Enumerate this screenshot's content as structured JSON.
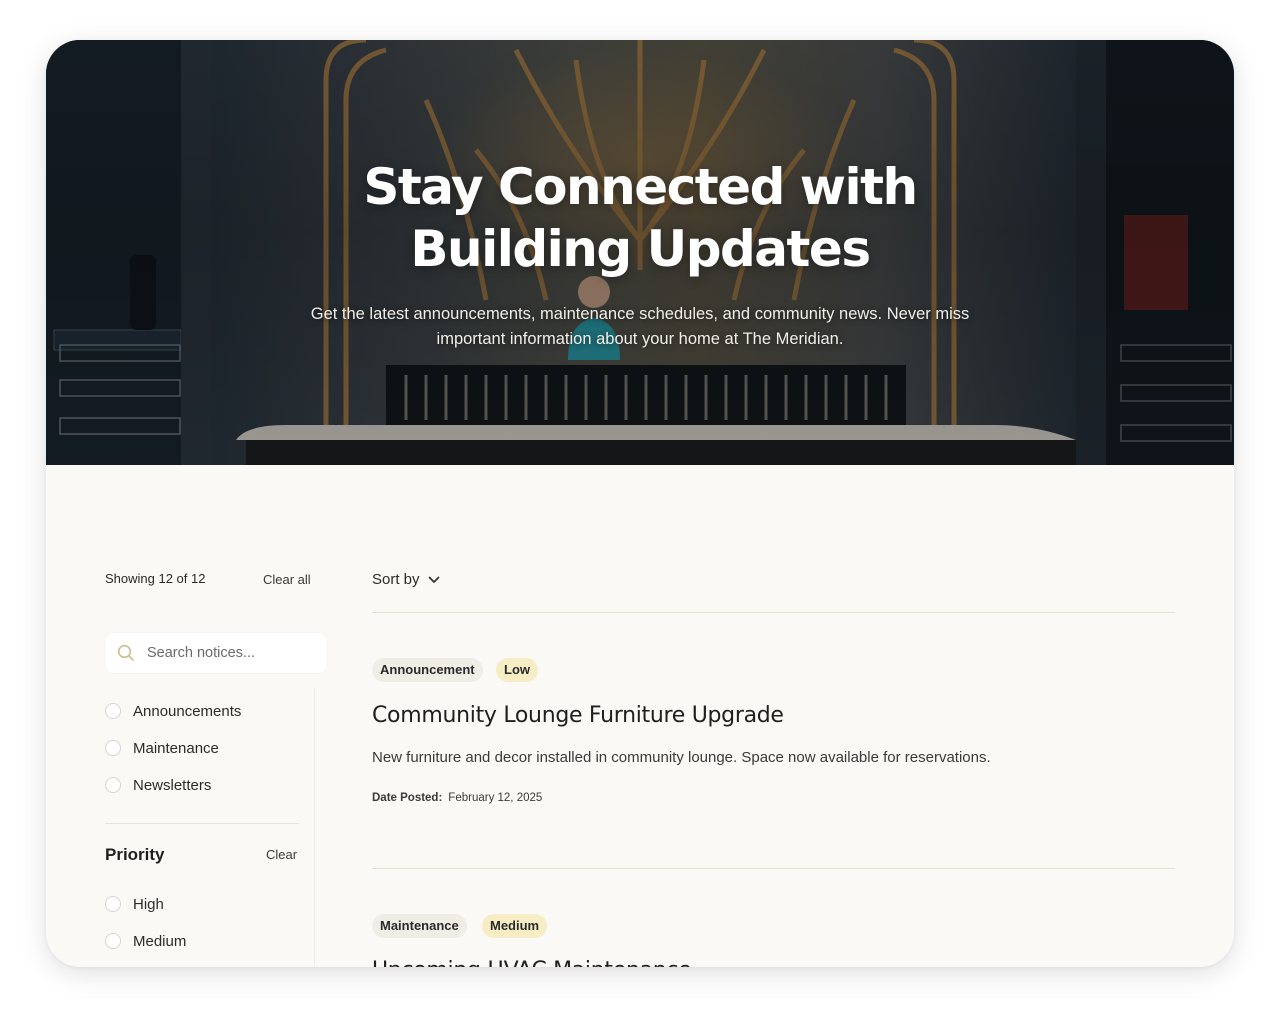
{
  "hero": {
    "title_line1": "Stay Connected with",
    "title_line2": "Building Updates",
    "subtitle_line1": "Get the latest announcements, maintenance schedules, and community news. Never miss",
    "subtitle_line2": "important information about your home at The Meridian."
  },
  "results": {
    "showing": "Showing 12 of 12",
    "clear_all": "Clear all"
  },
  "search": {
    "placeholder": "Search notices..."
  },
  "categories": [
    {
      "label": "Announcements"
    },
    {
      "label": "Maintenance"
    },
    {
      "label": "Newsletters"
    }
  ],
  "priority": {
    "title": "Priority",
    "clear": "Clear",
    "options": [
      {
        "label": "High"
      },
      {
        "label": "Medium"
      }
    ]
  },
  "sort": {
    "label": "Sort by"
  },
  "notices": [
    {
      "category": "Announcement",
      "priority": "Low",
      "title": "Community Lounge Furniture Upgrade",
      "description": "New furniture and decor installed in community lounge. Space now available for reservations.",
      "date_label": "Date Posted:",
      "date": "February 12, 2025"
    },
    {
      "category": "Maintenance",
      "priority": "Medium",
      "title": "Upcoming HVAC Maintenance"
    }
  ],
  "colors": {
    "page_bg": "#faf9f6",
    "category_badge": "#efede6",
    "priority_badge": "#f7edc4",
    "divider": "#e4e0c9"
  }
}
